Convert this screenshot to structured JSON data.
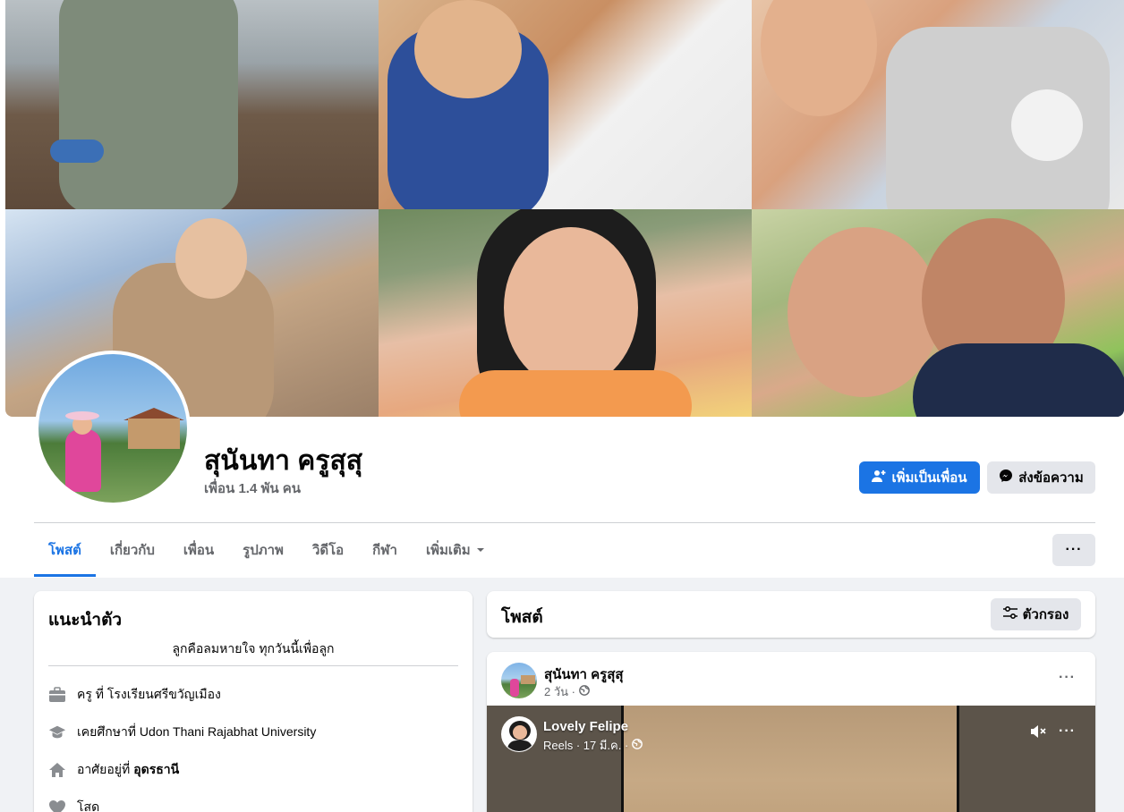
{
  "profile": {
    "name": "สุนันทา ครูสุสุ",
    "friends_count": "เพื่อน 1.4 พัน คน"
  },
  "actions": {
    "add_friend": "เพิ่มเป็นเพื่อน",
    "message": "ส่งข้อความ"
  },
  "tabs": [
    {
      "label": "โพสต์"
    },
    {
      "label": "เกี่ยวกับ"
    },
    {
      "label": "เพื่อน"
    },
    {
      "label": "รูปภาพ"
    },
    {
      "label": "วิดีโอ"
    },
    {
      "label": "กีฬา"
    },
    {
      "label": "เพิ่มเติม"
    }
  ],
  "more_button": "···",
  "intro": {
    "title": "แนะนำตัว",
    "bio": "ลูกคือลมหายใจ ทุกวันนี้เพื่อลูก",
    "work": "ครู ที่ โรงเรียนศรีขวัญเมือง",
    "education": "เคยศึกษาที่ Udon Thani Rajabhat University",
    "lives_prefix": "อาศัยอยู่ที่",
    "lives_city": "อุดรธานี",
    "relationship": "โสด"
  },
  "posts": {
    "title": "โพสต์",
    "filter_label": "ตัวกรอง"
  },
  "post": {
    "author": "สุนันทา ครูสุสุ",
    "time": "2 วัน ·",
    "dots": "···"
  },
  "reel": {
    "author": "Lovely Felipe",
    "meta": "Reels · 17 มี.ค. ·",
    "dots": "···"
  },
  "colors": {
    "accent": "#1b74e4",
    "background": "#f0f2f5",
    "secondary_text": "#65676b"
  },
  "icons": {
    "add_friend": "user-plus-icon",
    "message": "messenger-icon",
    "dropdown": "caret-down-icon",
    "work": "briefcase-icon",
    "education": "graduation-cap-icon",
    "home": "home-icon",
    "relationship": "heart-icon",
    "filter": "sliders-icon",
    "privacy": "globe-icon",
    "mute": "speaker-muted-icon"
  }
}
